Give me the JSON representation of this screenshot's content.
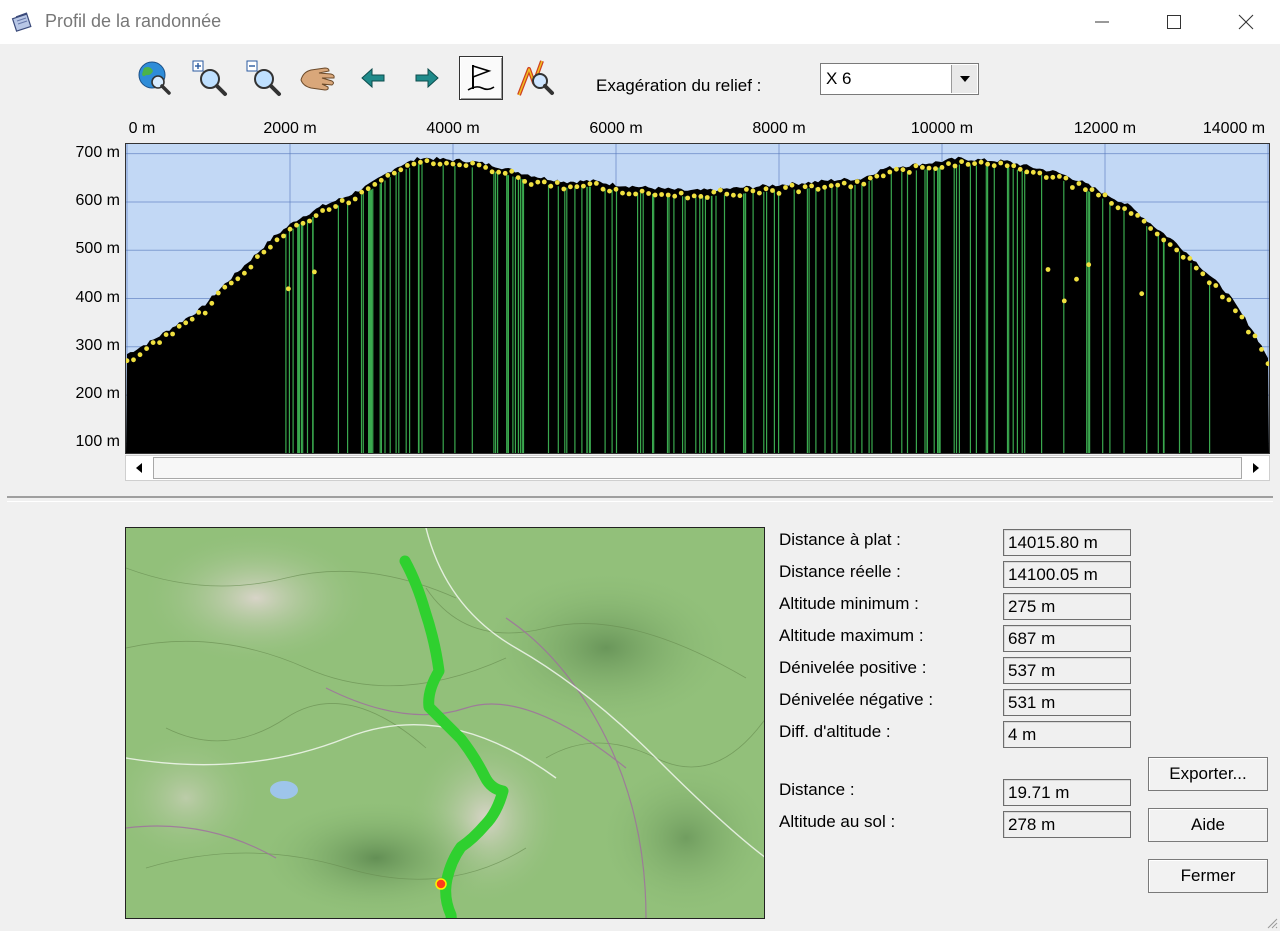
{
  "window": {
    "title": "Profil de la randonnée"
  },
  "toolbar": {
    "tools": [
      {
        "name": "globe-zoom-icon"
      },
      {
        "name": "zoom-in-icon"
      },
      {
        "name": "zoom-out-icon"
      },
      {
        "name": "pan-hand-icon"
      },
      {
        "name": "arrow-left-icon"
      },
      {
        "name": "arrow-right-icon"
      },
      {
        "name": "waypoint-flag-icon",
        "active": true
      },
      {
        "name": "route-zoom-icon"
      }
    ],
    "relief_label": "Exagération du relief :",
    "relief_value": "X 6"
  },
  "profile": {
    "x_ticks": [
      "0 m",
      "2000 m",
      "4000 m",
      "6000 m",
      "8000 m",
      "10000 m",
      "12000 m",
      "14000 m"
    ],
    "y_ticks": [
      "700 m",
      "600 m",
      "500 m",
      "400 m",
      "300 m",
      "200 m",
      "100 m"
    ],
    "colors": {
      "sky": "#c2d8f5",
      "terrain": "#000000",
      "points": "#f0e040",
      "markers": "#3aa84e",
      "grid": "#5577bb"
    }
  },
  "chart_data": {
    "type": "area",
    "title": "",
    "xlabel": "",
    "ylabel": "",
    "xlim": [
      0,
      14000
    ],
    "ylim": [
      80,
      720
    ],
    "x": [
      0,
      300,
      600,
      900,
      1200,
      1500,
      1800,
      2100,
      2400,
      2700,
      3000,
      3300,
      3600,
      3900,
      4200,
      4500,
      4800,
      5100,
      5400,
      5700,
      6000,
      6300,
      6600,
      6900,
      7200,
      7500,
      7800,
      8100,
      8400,
      8700,
      9000,
      9300,
      9600,
      9900,
      10200,
      10500,
      10800,
      11100,
      11400,
      11700,
      12000,
      12300,
      12600,
      12900,
      13200,
      13500,
      13800,
      14000
    ],
    "series": [
      {
        "values": [
          285,
          312,
          345,
          378,
          430,
          478,
          528,
          565,
          592,
          612,
          638,
          672,
          692,
          688,
          685,
          676,
          662,
          650,
          642,
          644,
          636,
          631,
          627,
          623,
          625,
          629,
          633,
          637,
          641,
          646,
          648,
          670,
          676,
          682,
          690,
          687,
          684,
          672,
          662,
          643,
          617,
          592,
          550,
          512,
          462,
          412,
          338,
          278
        ]
      }
    ]
  },
  "stats": [
    {
      "label": "Distance à plat :",
      "value": "14015.80 m"
    },
    {
      "label": "Distance réelle :",
      "value": "14100.05 m"
    },
    {
      "label": "Altitude minimum :",
      "value": "275 m"
    },
    {
      "label": "Altitude maximum :",
      "value": "687 m"
    },
    {
      "label": "Dénivelée positive :",
      "value": "537 m"
    },
    {
      "label": "Dénivelée négative :",
      "value": "531 m"
    },
    {
      "label": "Diff. d'altitude :",
      "value": "4 m"
    }
  ],
  "cursor": [
    {
      "label": "Distance :",
      "value": "19.71 m"
    },
    {
      "label": "Altitude au sol :",
      "value": "278 m"
    }
  ],
  "buttons": {
    "export": "Exporter...",
    "help": "Aide",
    "close": "Fermer"
  }
}
